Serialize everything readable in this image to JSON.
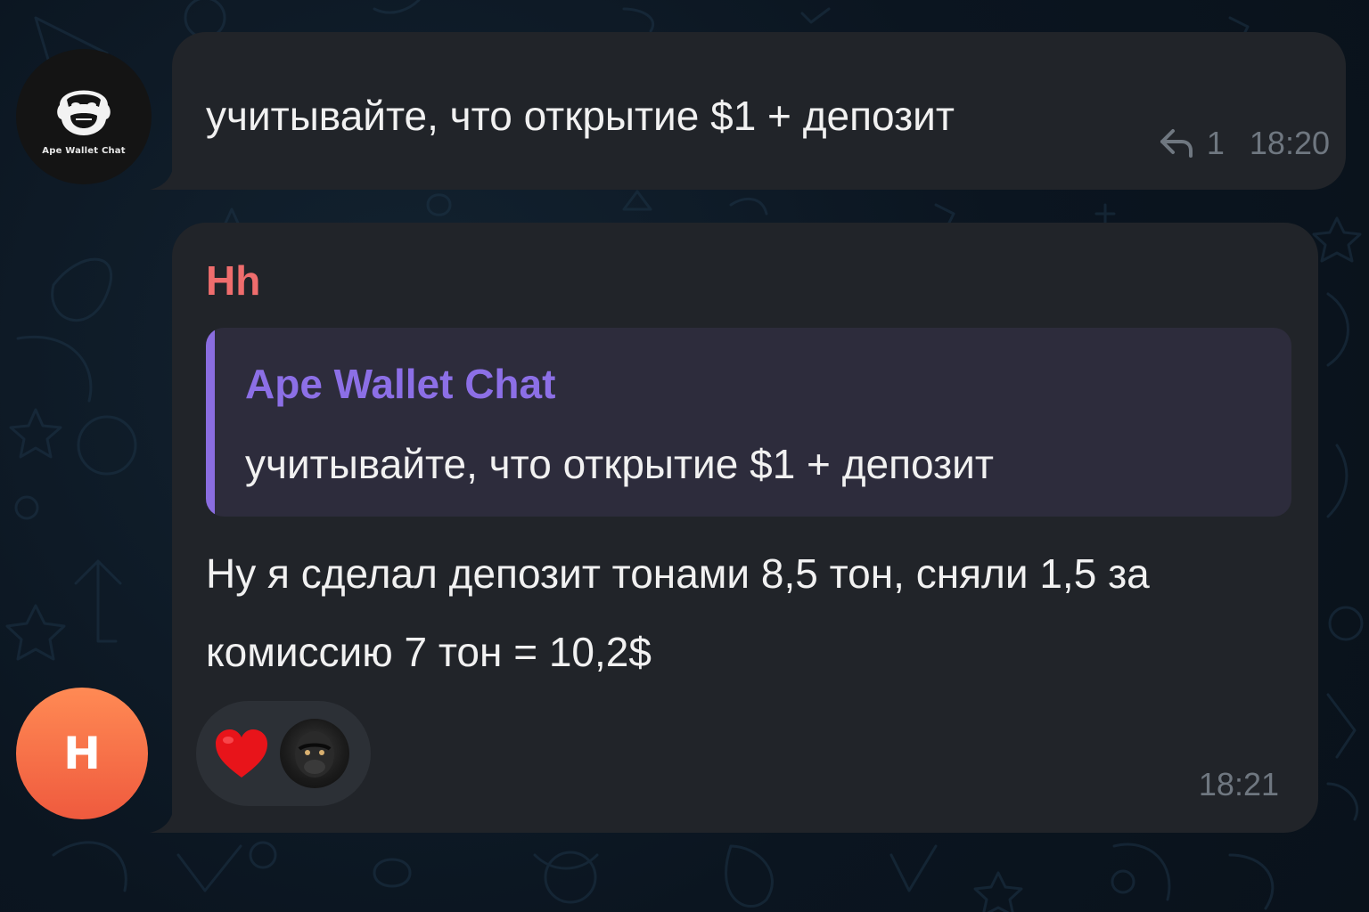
{
  "messages": [
    {
      "sender": "Ape Wallet Chat",
      "avatar_caption": "Ape Wallet Chat",
      "avatar_icon": "gorilla-logo-icon",
      "text": "учитывайте, что открытие $1 + депозит",
      "reply_count": "1",
      "time": "18:20"
    },
    {
      "sender": "Hh",
      "avatar_letter": "H",
      "quote": {
        "author": "Ape Wallet Chat",
        "text": "учитывайте, что открытие $1 + депозит"
      },
      "text": "Ну я сделал депозит тонами 8,5 тон, сняли 1,5 за комиссию 7 тон = 10,2$",
      "reaction": {
        "emoji": "heart-icon",
        "reactor_avatar": "ape-avatar-icon"
      },
      "time": "18:21"
    }
  ],
  "colors": {
    "background": "#0b1520",
    "bubble": "#212429",
    "sender_name": "#ef6d6d",
    "quote_accent": "#8c6fe6",
    "quote_bg": "#2d2c3c",
    "meta_text": "#6f7780",
    "avatar_h": "#ef5a3e"
  }
}
